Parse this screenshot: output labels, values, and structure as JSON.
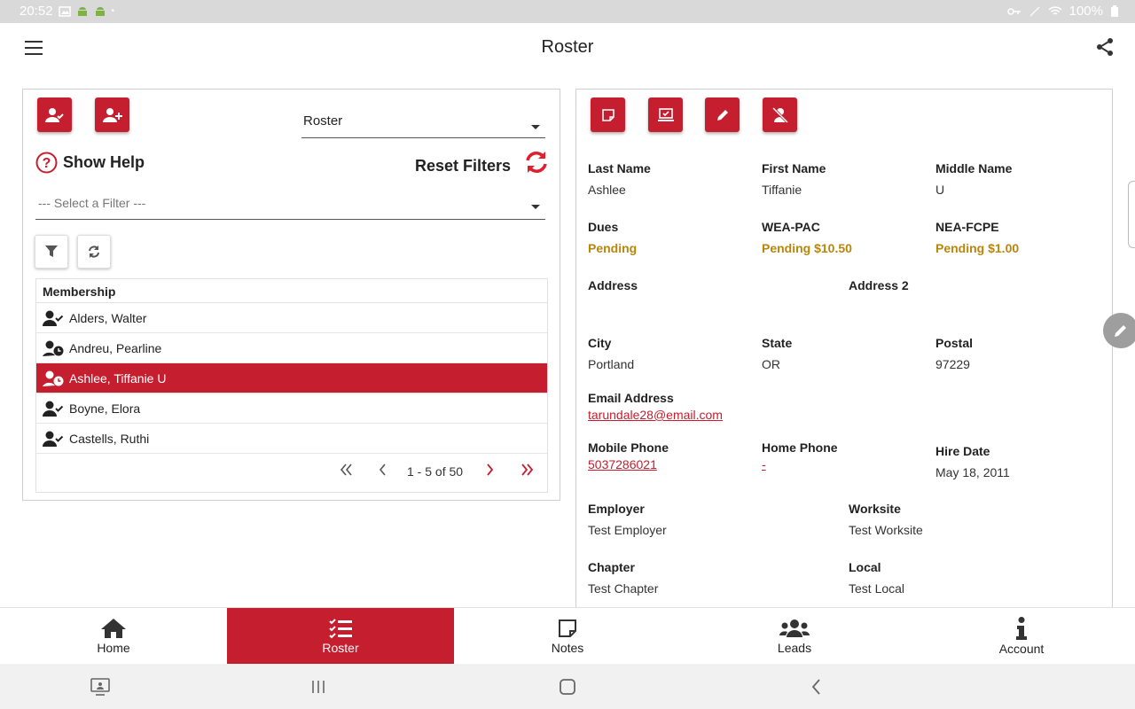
{
  "status_bar": {
    "time": "20:52",
    "battery": "100%"
  },
  "app_bar": {
    "title": "Roster"
  },
  "left": {
    "view_select": "Roster",
    "show_help": "Show Help",
    "reset_filters": "Reset Filters",
    "filter_placeholder": "--- Select a Filter ---",
    "grid_header": "Membership",
    "rows": [
      {
        "name": "Alders, Walter",
        "icon": "user-check-icon"
      },
      {
        "name": "Andreu, Pearline",
        "icon": "user-clock-icon"
      },
      {
        "name": "Ashlee, Tiffanie U",
        "icon": "user-clock-icon",
        "selected": true
      },
      {
        "name": "Boyne, Elora",
        "icon": "user-check-icon"
      },
      {
        "name": "Castells, Ruthi",
        "icon": "user-check-icon"
      }
    ],
    "pager_text": "1 - 5 of 50"
  },
  "detail": {
    "last_name": {
      "label": "Last Name",
      "value": "Ashlee"
    },
    "first_name": {
      "label": "First Name",
      "value": "Tiffanie"
    },
    "middle_name": {
      "label": "Middle Name",
      "value": "U"
    },
    "dues": {
      "label": "Dues",
      "value": "Pending"
    },
    "wea_pac": {
      "label": "WEA-PAC",
      "value": "Pending $10.50"
    },
    "nea_fcpe": {
      "label": "NEA-FCPE",
      "value": "Pending $1.00"
    },
    "address": {
      "label": "Address",
      "value": ""
    },
    "address2": {
      "label": "Address 2",
      "value": ""
    },
    "city": {
      "label": "City",
      "value": "Portland"
    },
    "state": {
      "label": "State",
      "value": "OR"
    },
    "postal": {
      "label": "Postal",
      "value": "97229"
    },
    "email": {
      "label": "Email Address",
      "value": "tarundale28@email.com"
    },
    "mobile": {
      "label": "Mobile Phone",
      "value": "5037286021"
    },
    "home_phone": {
      "label": "Home Phone",
      "value": "-"
    },
    "hire_date": {
      "label": "Hire Date",
      "value": "May 18, 2011"
    },
    "employer": {
      "label": "Employer",
      "value": "Test Employer"
    },
    "worksite": {
      "label": "Worksite",
      "value": "Test Worksite"
    },
    "chapter": {
      "label": "Chapter",
      "value": "Test Chapter"
    },
    "local": {
      "label": "Local",
      "value": "Test Local"
    }
  },
  "bottom_nav": {
    "home": "Home",
    "roster": "Roster",
    "notes": "Notes",
    "leads": "Leads",
    "account": "Account"
  },
  "colors": {
    "accent": "#c41e2f",
    "pending": "#b8860b"
  }
}
